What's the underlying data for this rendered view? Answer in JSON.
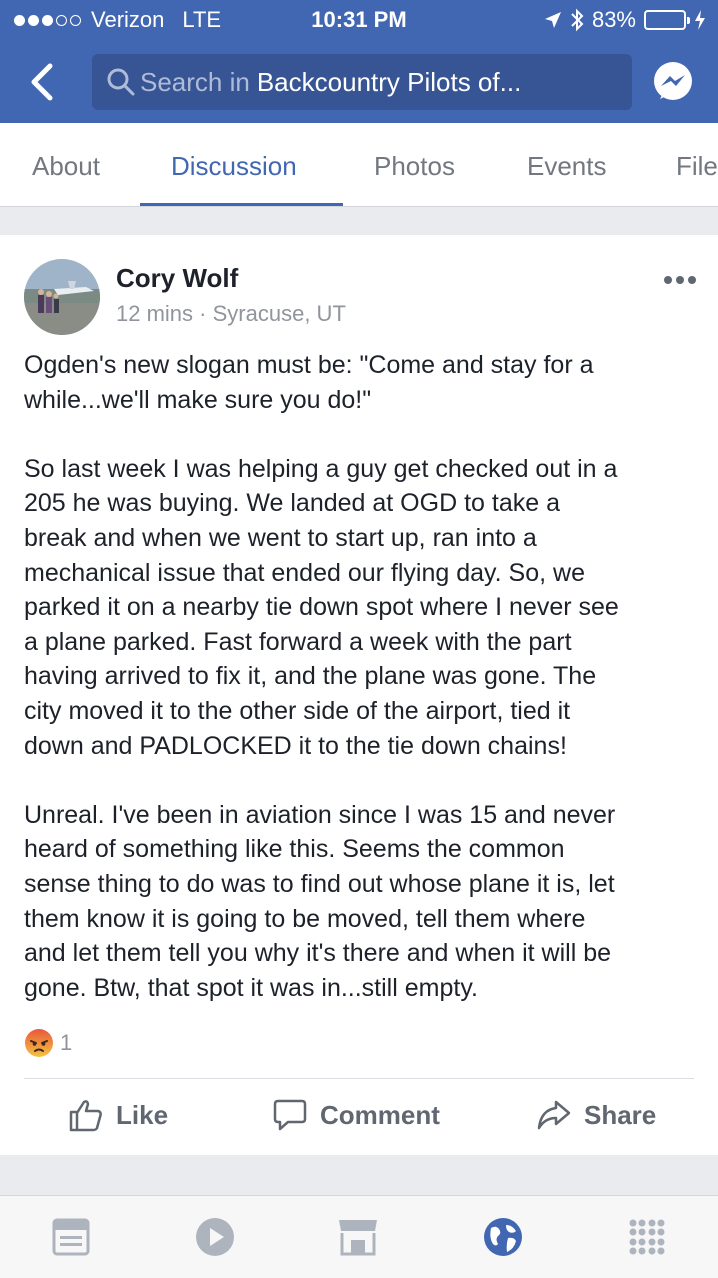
{
  "status_bar": {
    "carrier": "Verizon",
    "network": "LTE",
    "time": "10:31 PM",
    "battery": "83%",
    "battery_level": 0.83
  },
  "nav": {
    "search_placeholder": "Search in",
    "search_group": "Backcountry Pilots of..."
  },
  "tabs": [
    {
      "label": "About"
    },
    {
      "label": "Discussion"
    },
    {
      "label": "Photos"
    },
    {
      "label": "Events"
    },
    {
      "label": "File"
    }
  ],
  "post": {
    "author": "Cory Wolf",
    "time": "12 mins",
    "separator": "·",
    "location": "Syracuse, UT",
    "paragraphs": [
      [
        "Ogden's new slogan must be: \"Come and stay for a",
        "while...we'll make sure you do!\""
      ],
      [
        "So last week I was helping a guy get checked out in a",
        "205 he was buying.  We landed at OGD to take a",
        "break and when we went to start up, ran into a",
        "mechanical issue that ended our flying day.  So, we",
        "parked it on a nearby tie down spot where I never see",
        "a plane parked.  Fast forward a week with the part",
        "having arrived to fix it, and the plane was gone.  The",
        "city moved it to the other side of the airport, tied it",
        "down and PADLOCKED it to the tie down chains!"
      ],
      [
        "Unreal.  I've been in aviation since I was 15 and never",
        "heard of something like this.  Seems the common",
        "sense thing to do was to find out whose plane it is, let",
        "them know it is going to be moved, tell them where",
        "and let them tell you why it's there and when it will be",
        "gone.  Btw, that spot it was in...still empty."
      ]
    ],
    "reaction_count": "1",
    "actions": {
      "like": "Like",
      "comment": "Comment",
      "share": "Share"
    }
  },
  "colors": {
    "brand": "#4267b2",
    "search_bg": "#375594",
    "text": "#1d2129",
    "muted": "#90949c",
    "action": "#606770"
  },
  "bottom_tabs": [
    {
      "icon": "news-feed-icon"
    },
    {
      "icon": "video-icon"
    },
    {
      "icon": "marketplace-icon"
    },
    {
      "icon": "notifications-globe-icon",
      "active": true
    },
    {
      "icon": "menu-grid-icon"
    }
  ]
}
